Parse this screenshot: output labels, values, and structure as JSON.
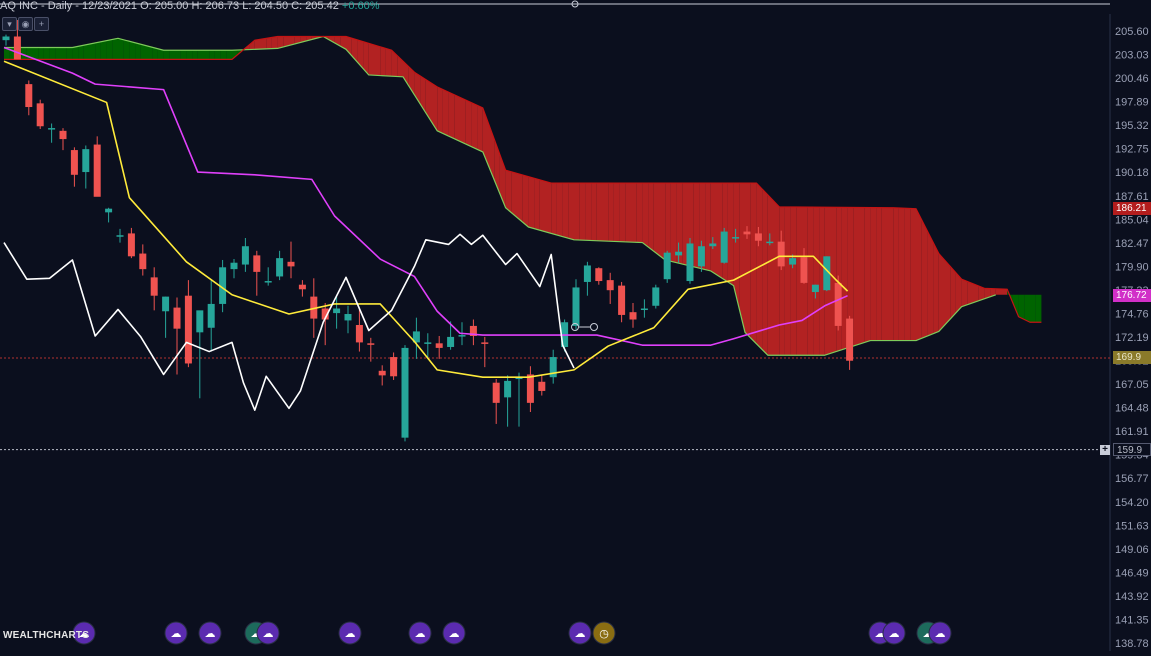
{
  "header": {
    "symbol": "AQ INC",
    "interval": "Daily",
    "date": "12/23/2021",
    "ohlc": "O: 205.00 H: 206.73 L: 204.50 C: 205.42",
    "change": "+0.60%"
  },
  "watermark": "WEALTHCHARTS",
  "toolbar": {
    "chevron": "▾",
    "eye": "◉",
    "plus": "+"
  },
  "price_tags": [
    {
      "label": "186.21",
      "value": 186.21,
      "bg": "#b31d1d",
      "fg": "#ffffff"
    },
    {
      "label": "176.72",
      "value": 176.72,
      "bg": "#d12fc8",
      "fg": "#ffffff"
    },
    {
      "label": "169.9",
      "value": 169.9,
      "bg": "#8a7a2a",
      "fg": "#e9e6c8"
    },
    {
      "label": "159.9",
      "value": 159.9,
      "bg": "#0b0f1e",
      "fg": "#b8bcc8"
    }
  ],
  "crosshair_plus": "+",
  "event_icons": {
    "count": 14,
    "symbol": "☁",
    "clock_symbol": "◷"
  },
  "colors": {
    "background": "#0b0f1e",
    "up": "#26a69a",
    "down": "#ef5350",
    "cloud_bull": "#006400",
    "cloud_bear": "#b22222",
    "span_a": "#7ecb5b",
    "span_b": "#c41414",
    "tenkan": "#ffeb3b",
    "kijun": "#e040fb",
    "chikou": "#ffffff",
    "axis_text": "#9aa0b5"
  },
  "chart_data": {
    "type": "candlestick",
    "title": "",
    "y_axis_ticks": [
      "205.60",
      "203.03",
      "200.46",
      "197.89",
      "195.32",
      "192.75",
      "190.18",
      "187.61",
      "185.04",
      "182.47",
      "179.90",
      "177.33",
      "174.76",
      "172.19",
      "169.62",
      "167.05",
      "164.48",
      "161.91",
      "159.34",
      "156.77",
      "154.20",
      "151.63",
      "149.06",
      "146.49",
      "143.92",
      "141.35",
      "138.78"
    ],
    "ylim": [
      138.78,
      205.6
    ],
    "candles": [
      {
        "o": 204.6,
        "h": 205.2,
        "l": 204.0,
        "c": 205.0
      },
      {
        "o": 205.0,
        "h": 206.8,
        "l": 203.8,
        "c": 202.5
      },
      {
        "o": 199.8,
        "h": 200.2,
        "l": 196.4,
        "c": 197.3
      },
      {
        "o": 197.7,
        "h": 198.1,
        "l": 194.9,
        "c": 195.2
      },
      {
        "o": 195.0,
        "h": 195.5,
        "l": 193.4,
        "c": 195.0
      },
      {
        "o": 194.7,
        "h": 195.0,
        "l": 192.6,
        "c": 193.8
      },
      {
        "o": 192.6,
        "h": 192.9,
        "l": 188.6,
        "c": 189.9
      },
      {
        "o": 190.2,
        "h": 193.1,
        "l": 188.4,
        "c": 192.7
      },
      {
        "o": 193.2,
        "h": 194.1,
        "l": 188.4,
        "c": 187.5
      },
      {
        "o": 185.8,
        "h": 186.3,
        "l": 184.7,
        "c": 186.2
      },
      {
        "o": 183.3,
        "h": 184.0,
        "l": 182.5,
        "c": 183.3
      },
      {
        "o": 183.5,
        "h": 184.1,
        "l": 180.8,
        "c": 181.0
      },
      {
        "o": 181.3,
        "h": 182.3,
        "l": 178.9,
        "c": 179.6
      },
      {
        "o": 178.7,
        "h": 179.8,
        "l": 175.1,
        "c": 176.7
      },
      {
        "o": 175.0,
        "h": 176.6,
        "l": 172.1,
        "c": 176.6
      },
      {
        "o": 175.4,
        "h": 176.5,
        "l": 168.1,
        "c": 173.1
      },
      {
        "o": 176.7,
        "h": 178.4,
        "l": 168.9,
        "c": 169.3
      },
      {
        "o": 172.7,
        "h": 173.8,
        "l": 165.5,
        "c": 175.1
      },
      {
        "o": 173.2,
        "h": 178.5,
        "l": 170.6,
        "c": 175.8
      },
      {
        "o": 175.8,
        "h": 180.6,
        "l": 174.9,
        "c": 179.8
      },
      {
        "o": 179.6,
        "h": 180.7,
        "l": 178.6,
        "c": 180.3
      },
      {
        "o": 180.1,
        "h": 183.0,
        "l": 179.3,
        "c": 182.1
      },
      {
        "o": 181.1,
        "h": 181.6,
        "l": 176.7,
        "c": 179.3
      },
      {
        "o": 178.3,
        "h": 179.8,
        "l": 177.8,
        "c": 178.3
      },
      {
        "o": 178.8,
        "h": 181.6,
        "l": 178.4,
        "c": 180.8
      },
      {
        "o": 180.4,
        "h": 182.6,
        "l": 178.6,
        "c": 179.9
      },
      {
        "o": 177.9,
        "h": 178.4,
        "l": 176.6,
        "c": 177.4
      },
      {
        "o": 176.6,
        "h": 178.6,
        "l": 172.1,
        "c": 174.2
      },
      {
        "o": 175.3,
        "h": 175.9,
        "l": 171.3,
        "c": 174.1
      },
      {
        "o": 174.8,
        "h": 176.6,
        "l": 173.1,
        "c": 175.3
      },
      {
        "o": 174.0,
        "h": 175.6,
        "l": 172.6,
        "c": 174.7
      },
      {
        "o": 173.5,
        "h": 175.3,
        "l": 170.6,
        "c": 171.6
      },
      {
        "o": 171.5,
        "h": 172.1,
        "l": 169.5,
        "c": 171.4
      },
      {
        "o": 168.5,
        "h": 169.1,
        "l": 166.9,
        "c": 168.0
      },
      {
        "o": 170.0,
        "h": 170.5,
        "l": 167.5,
        "c": 167.9
      },
      {
        "o": 161.2,
        "h": 171.3,
        "l": 160.8,
        "c": 171.0
      },
      {
        "o": 171.6,
        "h": 174.3,
        "l": 169.8,
        "c": 172.8
      },
      {
        "o": 171.5,
        "h": 172.6,
        "l": 169.8,
        "c": 171.6
      },
      {
        "o": 171.5,
        "h": 172.3,
        "l": 169.8,
        "c": 171.0
      },
      {
        "o": 171.1,
        "h": 173.9,
        "l": 170.8,
        "c": 172.2
      },
      {
        "o": 172.4,
        "h": 173.8,
        "l": 171.3,
        "c": 172.4
      },
      {
        "o": 173.4,
        "h": 174.1,
        "l": 171.3,
        "c": 172.3
      },
      {
        "o": 171.6,
        "h": 172.2,
        "l": 168.9,
        "c": 171.5
      },
      {
        "o": 167.2,
        "h": 167.6,
        "l": 162.7,
        "c": 165.0
      },
      {
        "o": 165.6,
        "h": 168.0,
        "l": 162.4,
        "c": 167.4
      },
      {
        "o": 167.6,
        "h": 168.3,
        "l": 162.4,
        "c": 167.8
      },
      {
        "o": 168.1,
        "h": 169.0,
        "l": 164.0,
        "c": 165.0
      },
      {
        "o": 167.3,
        "h": 168.0,
        "l": 165.8,
        "c": 166.3
      },
      {
        "o": 167.8,
        "h": 170.8,
        "l": 167.1,
        "c": 170.0
      },
      {
        "o": 171.1,
        "h": 174.1,
        "l": 170.6,
        "c": 173.8
      },
      {
        "o": 173.4,
        "h": 178.5,
        "l": 173.0,
        "c": 177.6
      },
      {
        "o": 178.2,
        "h": 180.4,
        "l": 176.7,
        "c": 180.0
      },
      {
        "o": 179.7,
        "h": 179.8,
        "l": 177.9,
        "c": 178.3
      },
      {
        "o": 178.4,
        "h": 179.2,
        "l": 175.8,
        "c": 177.3
      },
      {
        "o": 177.8,
        "h": 178.2,
        "l": 173.8,
        "c": 174.6
      },
      {
        "o": 174.9,
        "h": 175.9,
        "l": 173.2,
        "c": 174.1
      },
      {
        "o": 175.2,
        "h": 176.3,
        "l": 174.3,
        "c": 175.3
      },
      {
        "o": 175.6,
        "h": 177.9,
        "l": 175.3,
        "c": 177.6
      },
      {
        "o": 178.5,
        "h": 181.6,
        "l": 178.1,
        "c": 181.4
      },
      {
        "o": 181.1,
        "h": 182.5,
        "l": 180.3,
        "c": 181.5
      },
      {
        "o": 178.3,
        "h": 183.0,
        "l": 178.0,
        "c": 182.4
      },
      {
        "o": 179.9,
        "h": 182.7,
        "l": 179.3,
        "c": 182.1
      },
      {
        "o": 182.1,
        "h": 183.1,
        "l": 181.8,
        "c": 182.4
      },
      {
        "o": 180.3,
        "h": 184.1,
        "l": 180.2,
        "c": 183.7
      },
      {
        "o": 183.1,
        "h": 184.0,
        "l": 182.5,
        "c": 183.1
      },
      {
        "o": 183.7,
        "h": 184.3,
        "l": 182.9,
        "c": 183.4
      },
      {
        "o": 183.5,
        "h": 184.2,
        "l": 182.1,
        "c": 182.7
      },
      {
        "o": 182.6,
        "h": 183.5,
        "l": 182.2,
        "c": 182.6
      },
      {
        "o": 182.6,
        "h": 183.8,
        "l": 179.5,
        "c": 179.9
      },
      {
        "o": 180.1,
        "h": 181.2,
        "l": 179.7,
        "c": 180.8
      },
      {
        "o": 180.9,
        "h": 181.9,
        "l": 178.0,
        "c": 178.1
      },
      {
        "o": 177.1,
        "h": 177.9,
        "l": 176.4,
        "c": 177.9
      },
      {
        "o": 177.3,
        "h": 181.0,
        "l": 177.2,
        "c": 181.0
      },
      {
        "o": 178.1,
        "h": 178.9,
        "l": 172.9,
        "c": 173.4
      },
      {
        "o": 174.2,
        "h": 174.5,
        "l": 168.6,
        "c": 169.6
      }
    ],
    "tenkan_sen": [
      {
        "i": 0,
        "v": 202.3
      },
      {
        "i": 9,
        "v": 197.8
      },
      {
        "i": 11,
        "v": 187.4
      },
      {
        "i": 16,
        "v": 180.4
      },
      {
        "i": 20,
        "v": 176.8
      },
      {
        "i": 25,
        "v": 174.7
      },
      {
        "i": 29,
        "v": 175.8
      },
      {
        "i": 33,
        "v": 175.8
      },
      {
        "i": 36,
        "v": 171.7
      },
      {
        "i": 38,
        "v": 168.6
      },
      {
        "i": 42,
        "v": 167.8
      },
      {
        "i": 46,
        "v": 167.8
      },
      {
        "i": 50,
        "v": 168.6
      },
      {
        "i": 53,
        "v": 171.2
      },
      {
        "i": 57,
        "v": 173.2
      },
      {
        "i": 60,
        "v": 177.4
      },
      {
        "i": 64,
        "v": 178.4
      },
      {
        "i": 68,
        "v": 181.0
      },
      {
        "i": 71,
        "v": 181.0
      },
      {
        "i": 73,
        "v": 178.4
      },
      {
        "i": 74,
        "v": 177.2
      }
    ],
    "kijun_sen": [
      {
        "i": 0,
        "v": 203.8
      },
      {
        "i": 6,
        "v": 201.0
      },
      {
        "i": 8,
        "v": 199.8
      },
      {
        "i": 14,
        "v": 199.2
      },
      {
        "i": 17,
        "v": 190.2
      },
      {
        "i": 22,
        "v": 189.9
      },
      {
        "i": 27,
        "v": 189.4
      },
      {
        "i": 29,
        "v": 185.4
      },
      {
        "i": 33,
        "v": 180.7
      },
      {
        "i": 36,
        "v": 178.8
      },
      {
        "i": 38,
        "v": 175.0
      },
      {
        "i": 40,
        "v": 172.6
      },
      {
        "i": 42,
        "v": 172.4
      },
      {
        "i": 47,
        "v": 172.4
      },
      {
        "i": 52,
        "v": 172.4
      },
      {
        "i": 56,
        "v": 171.3
      },
      {
        "i": 62,
        "v": 171.3
      },
      {
        "i": 64,
        "v": 172.0
      },
      {
        "i": 68,
        "v": 173.5
      },
      {
        "i": 70,
        "v": 174.0
      },
      {
        "i": 72,
        "v": 175.6
      },
      {
        "i": 74,
        "v": 176.7
      }
    ],
    "chikou_span": [
      {
        "i": 0,
        "v": 182.5
      },
      {
        "i": 2,
        "v": 178.5
      },
      {
        "i": 4,
        "v": 178.6
      },
      {
        "i": 6,
        "v": 180.6
      },
      {
        "i": 8,
        "v": 172.3
      },
      {
        "i": 10,
        "v": 175.2
      },
      {
        "i": 12,
        "v": 172.2
      },
      {
        "i": 14,
        "v": 168.1
      },
      {
        "i": 16,
        "v": 171.6
      },
      {
        "i": 18,
        "v": 170.6
      },
      {
        "i": 20,
        "v": 171.6
      },
      {
        "i": 21,
        "v": 167.2
      },
      {
        "i": 22,
        "v": 164.2
      },
      {
        "i": 23,
        "v": 167.9
      },
      {
        "i": 25,
        "v": 164.4
      },
      {
        "i": 26,
        "v": 166.3
      },
      {
        "i": 28,
        "v": 173.8
      },
      {
        "i": 30,
        "v": 178.7
      },
      {
        "i": 32,
        "v": 172.9
      },
      {
        "i": 34,
        "v": 175.1
      },
      {
        "i": 36,
        "v": 179.9
      },
      {
        "i": 37,
        "v": 182.8
      },
      {
        "i": 39,
        "v": 182.3
      },
      {
        "i": 40,
        "v": 183.4
      },
      {
        "i": 41,
        "v": 182.3
      },
      {
        "i": 42,
        "v": 183.3
      },
      {
        "i": 44,
        "v": 180.1
      },
      {
        "i": 45,
        "v": 181.3
      },
      {
        "i": 47,
        "v": 177.7
      },
      {
        "i": 48,
        "v": 181.2
      },
      {
        "i": 49,
        "v": 171.3
      },
      {
        "i": 50,
        "v": 168.8
      }
    ],
    "cloud": {
      "span_a": [
        {
          "i": 0,
          "v": 203.8
        },
        {
          "i": 6,
          "v": 203.8
        },
        {
          "i": 10,
          "v": 204.8
        },
        {
          "i": 14,
          "v": 203.5
        },
        {
          "i": 16,
          "v": 203.5
        },
        {
          "i": 20,
          "v": 203.5
        },
        {
          "i": 24,
          "v": 203.7
        },
        {
          "i": 28,
          "v": 205.0
        },
        {
          "i": 30,
          "v": 203.6
        },
        {
          "i": 32,
          "v": 200.8
        },
        {
          "i": 35,
          "v": 200.6
        },
        {
          "i": 38,
          "v": 194.7
        },
        {
          "i": 42,
          "v": 192.4
        },
        {
          "i": 44,
          "v": 186.3
        },
        {
          "i": 46,
          "v": 184.2
        },
        {
          "i": 50,
          "v": 182.8
        },
        {
          "i": 56,
          "v": 182.5
        },
        {
          "i": 58,
          "v": 180.6
        },
        {
          "i": 62,
          "v": 179.4
        },
        {
          "i": 64,
          "v": 177.8
        },
        {
          "i": 65,
          "v": 172.7
        },
        {
          "i": 67,
          "v": 170.2
        },
        {
          "i": 72,
          "v": 170.2
        },
        {
          "i": 76,
          "v": 171.8
        },
        {
          "i": 80,
          "v": 171.8
        },
        {
          "i": 82,
          "v": 172.8
        },
        {
          "i": 84,
          "v": 175.5
        },
        {
          "i": 87,
          "v": 176.8
        }
      ],
      "span_b": [
        {
          "i": 0,
          "v": 202.5
        },
        {
          "i": 20,
          "v": 202.5
        },
        {
          "i": 22,
          "v": 204.6
        },
        {
          "i": 24,
          "v": 205.0
        },
        {
          "i": 30,
          "v": 205.0
        },
        {
          "i": 34,
          "v": 203.5
        },
        {
          "i": 36,
          "v": 201.1
        },
        {
          "i": 38,
          "v": 199.5
        },
        {
          "i": 42,
          "v": 197.2
        },
        {
          "i": 44,
          "v": 190.4
        },
        {
          "i": 48,
          "v": 189.0
        },
        {
          "i": 66,
          "v": 189.0
        },
        {
          "i": 68,
          "v": 186.4
        },
        {
          "i": 78,
          "v": 186.3
        },
        {
          "i": 80,
          "v": 186.2
        },
        {
          "i": 82,
          "v": 181.3
        },
        {
          "i": 84,
          "v": 178.5
        },
        {
          "i": 86,
          "v": 177.5
        },
        {
          "i": 88,
          "v": 177.4
        },
        {
          "i": 89,
          "v": 174.4
        },
        {
          "i": 90,
          "v": 173.8
        },
        {
          "i": 91,
          "v": 173.8
        }
      ]
    },
    "reference_line": 169.9,
    "crosshair_value": 159.9
  }
}
